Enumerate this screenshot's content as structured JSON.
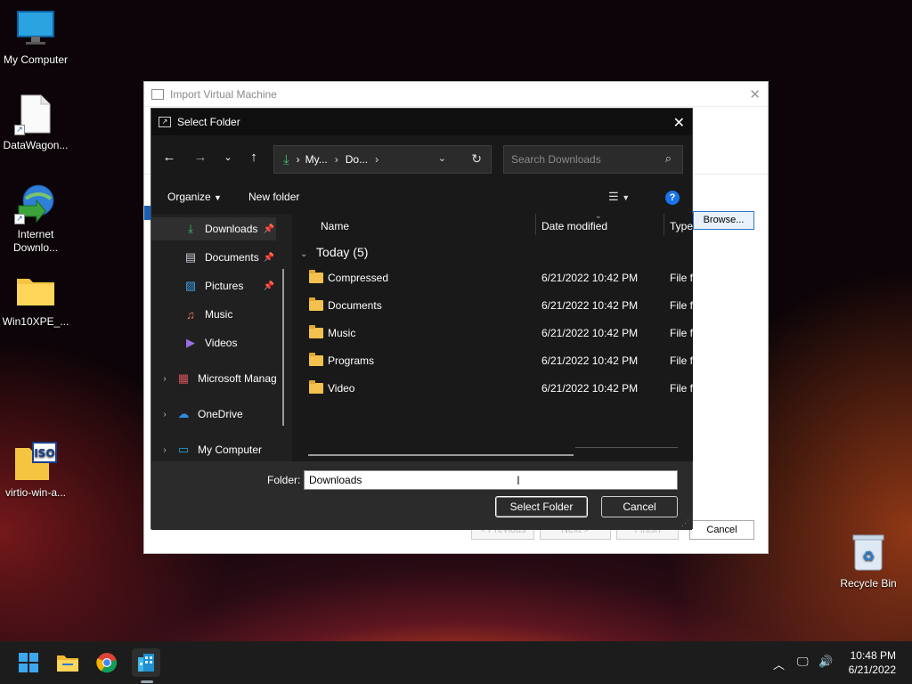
{
  "desktop": {
    "icons": [
      {
        "label": "My Computer"
      },
      {
        "label": "DataWagon..."
      },
      {
        "label": "Internet Downlo..."
      },
      {
        "label": "Win10XPE_..."
      },
      {
        "label": "virtio-win-a..."
      },
      {
        "label": "Recycle Bin"
      }
    ]
  },
  "bg_dialog": {
    "title": "Import Virtual Machine",
    "browse_label": "Browse...",
    "prev_label": "< Previous",
    "next_label": "Next >",
    "finish_label": "Finish",
    "cancel_label": "Cancel"
  },
  "dialog": {
    "title": "Select Folder",
    "address": {
      "crumb1": "My...",
      "crumb2": "Do..."
    },
    "search_placeholder": "Search Downloads",
    "toolbar": {
      "organize": "Organize",
      "new_folder": "New folder"
    },
    "nav": [
      {
        "label": "Downloads",
        "pinned": true
      },
      {
        "label": "Documents",
        "pinned": true
      },
      {
        "label": "Pictures",
        "pinned": true
      },
      {
        "label": "Music"
      },
      {
        "label": "Videos"
      },
      {
        "label": "Microsoft Manag"
      },
      {
        "label": "OneDrive"
      },
      {
        "label": "My Computer"
      }
    ],
    "columns": {
      "name": "Name",
      "date": "Date modified",
      "type": "Type"
    },
    "group_label": "Today (5)",
    "rows": [
      {
        "name": "Compressed",
        "date": "6/21/2022 10:42 PM",
        "type": "File fo"
      },
      {
        "name": "Documents",
        "date": "6/21/2022 10:42 PM",
        "type": "File fo"
      },
      {
        "name": "Music",
        "date": "6/21/2022 10:42 PM",
        "type": "File fo"
      },
      {
        "name": "Programs",
        "date": "6/21/2022 10:42 PM",
        "type": "File fo"
      },
      {
        "name": "Video",
        "date": "6/21/2022 10:42 PM",
        "type": "File fo"
      }
    ],
    "folder_label": "Folder:",
    "folder_value": "Downloads",
    "select_label": "Select Folder",
    "cancel_label": "Cancel"
  },
  "taskbar": {
    "time": "10:48 PM",
    "date": "6/21/2022"
  }
}
